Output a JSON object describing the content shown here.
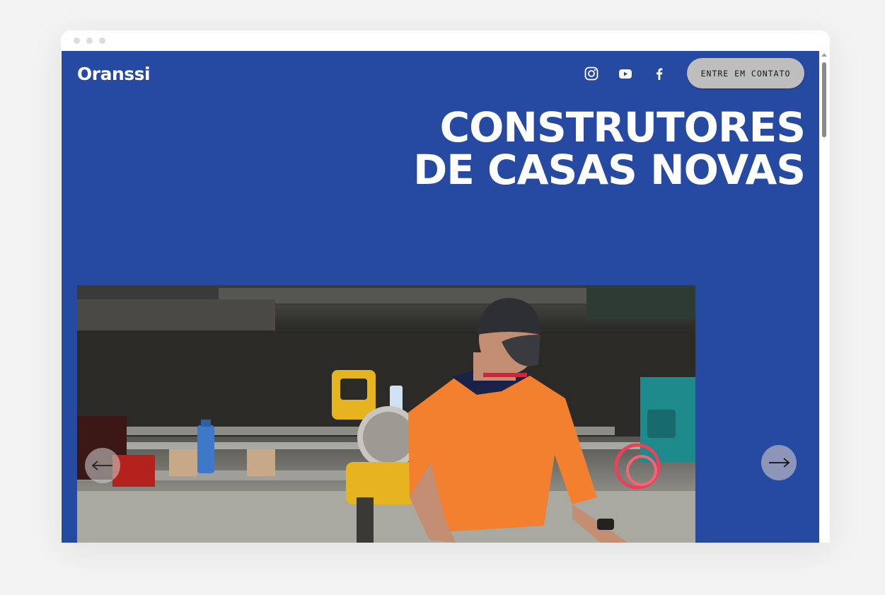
{
  "header": {
    "logo": "Oranssi",
    "social": [
      {
        "name": "instagram-icon"
      },
      {
        "name": "youtube-icon"
      },
      {
        "name": "facebook-icon"
      }
    ],
    "cta_label": "ENTRE EM CONTATO"
  },
  "hero": {
    "headline_line1": "CONSTRUTORES",
    "headline_line2": "DE CASAS NOVAS"
  },
  "gallery": {
    "image": "construction worker in orange polo shirt and black cap operating a yellow miter saw",
    "prev_icon": "arrow-left-icon",
    "next_icon": "arrow-right-icon"
  },
  "colors": {
    "brand_blue": "#2649a1",
    "cta_bg": "#bebebe",
    "worker_shirt": "#f2802e",
    "saw_yellow": "#e6b420"
  }
}
